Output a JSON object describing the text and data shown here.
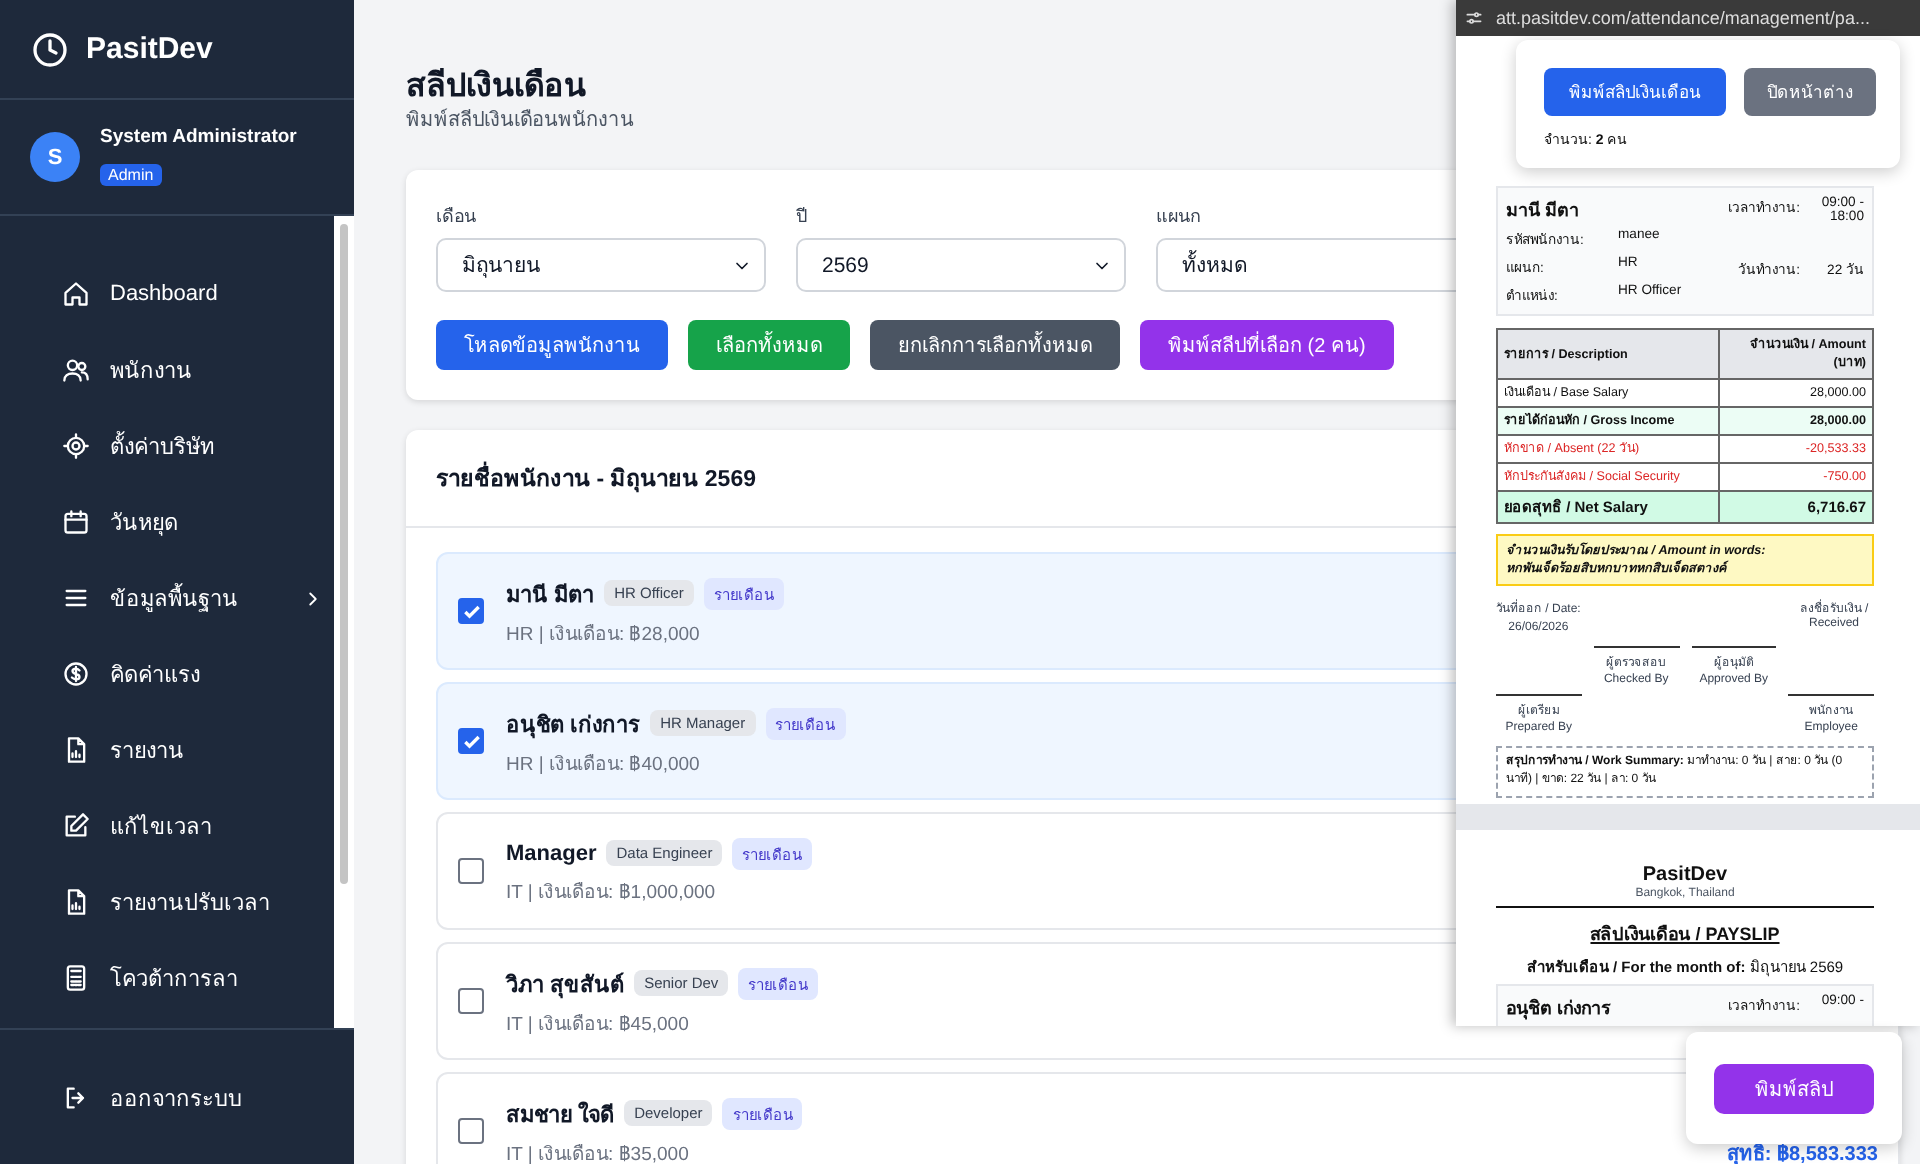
{
  "sidebar": {
    "brand": "PasitDev",
    "user": {
      "avatar": "S",
      "name": "System Administrator",
      "role": "Admin"
    },
    "items": [
      {
        "label": "Dashboard",
        "has_submenu": false
      },
      {
        "label": "พนักงาน",
        "has_submenu": false
      },
      {
        "label": "ตั้งค่าบริษัท",
        "has_submenu": false
      },
      {
        "label": "วันหยุด",
        "has_submenu": false
      },
      {
        "label": "ข้อมูลพื้นฐาน",
        "has_submenu": true
      },
      {
        "label": "คิดค่าแรง",
        "has_submenu": false
      },
      {
        "label": "รายงาน",
        "has_submenu": false
      },
      {
        "label": "แก้ไขเวลา",
        "has_submenu": false
      },
      {
        "label": "รายงานปรับเวลา",
        "has_submenu": false
      },
      {
        "label": "โควต้าการลา",
        "has_submenu": false
      }
    ],
    "logout": "ออกจากระบบ"
  },
  "page": {
    "title": "สลีปเงินเดือน",
    "subtitle": "พิมพ์สลีปเงินเดือนพนักงาน"
  },
  "filters": [
    {
      "label": "เดือน",
      "value": "มิถุนายน"
    },
    {
      "label": "ปี",
      "value": "2569"
    },
    {
      "label": "แผนก",
      "value": "ทั้งหมด"
    }
  ],
  "actions": [
    {
      "label": "โหลดข้อมูลพนักงาน",
      "kind": "primary"
    },
    {
      "label": "เลือกทั้งหมด",
      "kind": "success"
    },
    {
      "label": "ยกเลิกการเลือกทั้งหมด",
      "kind": "secondary"
    },
    {
      "label": "พิมพ์สลีปที่เลือก (2 คน)",
      "kind": "print"
    }
  ],
  "employee_list": {
    "title": "รายชื่อพนักงาน - มิถุนายน 2569",
    "rows": [
      {
        "name": "มานี มีตา",
        "position": "HR Officer",
        "pay_type": "รายเดือน",
        "details": "HR | เงินเดือน: ฿28,000",
        "selected": true
      },
      {
        "name": "อนุชิต เก่งการ",
        "position": "HR Manager",
        "pay_type": "รายเดือน",
        "details": "HR | เงินเดือน: ฿40,000",
        "selected": true
      },
      {
        "name": "Manager",
        "position": "Data Engineer",
        "pay_type": "รายเดือน",
        "details": "IT | เงินเดือน: ฿1,000,000",
        "selected": false
      },
      {
        "name": "วิภา สุขสันต์",
        "position": "Senior Dev",
        "pay_type": "รายเดือน",
        "details": "IT | เงินเดือน: ฿45,000",
        "selected": false
      },
      {
        "name": "สมชาย ใจดี",
        "position": "Developer",
        "pay_type": "รายเดือน",
        "details": "IT | เงินเดือน: ฿35,000",
        "selected": false,
        "net": "สุทธิ: ฿8,583.333"
      }
    ]
  },
  "popup": {
    "url": "att.pasitdev.com/attendance/management/pa...",
    "toolbar": {
      "buttons": [
        {
          "label": "พิมพ์สลิปเงินเดือน",
          "kind": "primary"
        },
        {
          "label": "ปิดหน้าต่าง",
          "kind": "secondary"
        }
      ],
      "count": "จำนวน: **2** คน"
    },
    "payslips": [
      {
        "name": "มานี มีตา",
        "left_fields": [
          {
            "label": "รหัสพนักงาน:",
            "value": "manee"
          },
          {
            "label": "แผนก:",
            "value": "HR"
          },
          {
            "label": "ตำแหน่ง:",
            "value": "HR Officer"
          }
        ],
        "right_fields": [
          {
            "label": "เวลาทำงาน:",
            "value": "09:00 - 18:00"
          },
          {
            "label": "วันทำงาน:",
            "value": "22 วัน"
          }
        ],
        "table": {
          "columns": [
            "รายการ / Description",
            "จำนวนเงิน / Amount (บาท)"
          ],
          "lines": [
            {
              "description": "เงินเดือน / Base Salary",
              "amount": "28,000.00",
              "kind": "normal"
            },
            {
              "description": "รายได้ก่อนหัก / Gross Income",
              "amount": "28,000.00",
              "kind": "gross"
            },
            {
              "description": "หักขาด / Absent (22 วัน)",
              "amount": "-20,533.33",
              "kind": "deduction"
            },
            {
              "description": "หักประกันสังคม / Social Security",
              "amount": "-750.00",
              "kind": "deduction"
            },
            {
              "description": "ยอดสุทธิ / Net Salary",
              "amount": "6,716.67",
              "kind": "net"
            }
          ]
        },
        "words_label": "จำนวนเงินรับโดยประมาณ / Amount in words:",
        "words": "หกพันเจ็ดร้อยสิบหกบาทหกสิบเจ็ดสตางค์",
        "date_label": "วันที่ออก / Date:",
        "date": "26/06/2026",
        "received": "ลงชื่อรับเงิน / Received",
        "signatures": [
          {
            "th": "ผู้เตรียม",
            "en": "Prepared By"
          },
          {
            "th": "ผู้ตรวจสอบ",
            "en": "Checked By"
          },
          {
            "th": "ผู้อนุมัติ",
            "en": "Approved By"
          },
          {
            "th": "พนักงาน",
            "en": "Employee"
          }
        ],
        "summary": "**สรุปการทำงาน / Work Summary:** มาทำงาน: 0 วัน | สาย: 0 วัน (0 นาที) | ขาด: 22 วัน | ลา: 0 วัน"
      },
      {
        "company": "PasitDev",
        "address": "Bangkok, Thailand",
        "heading": "สลิปเงินเดือน / PAYSLIP",
        "month": "**สำหรับเดือน / For the month of:** มิถุนายน 2569",
        "name": "อนุชิต เก่งการ",
        "right_fields": [
          {
            "label": "เวลาทำงาน:",
            "value": "09:00 -"
          }
        ]
      }
    ]
  },
  "print_button": "พิมพ์สลิป"
}
